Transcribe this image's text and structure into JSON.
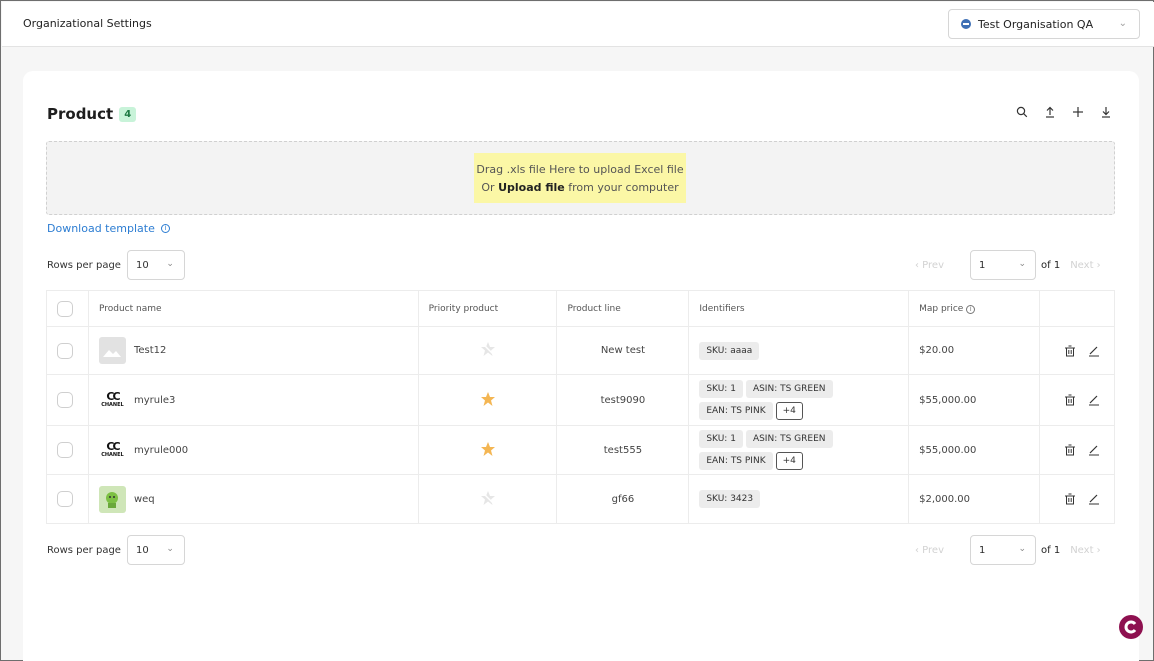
{
  "header": {
    "title": "Organizational Settings",
    "org_selector": {
      "value": "Test Organisation QA"
    }
  },
  "product": {
    "heading": "Product",
    "count": "4",
    "toolbar_icons": [
      "search-icon",
      "upload-icon",
      "add-icon",
      "download-icon"
    ]
  },
  "upload": {
    "line1": "Drag .xls file Here to upload Excel file",
    "line2_prefix": "Or ",
    "line2_link": "Upload file",
    "line2_suffix": " from your computer"
  },
  "download_template": "Download template",
  "pagination": {
    "rows_per_page_label": "Rows per page",
    "rows_per_page_value": "10",
    "prev": "‹ Prev",
    "page": "1",
    "of": "of 1",
    "next": "Next ›"
  },
  "table": {
    "columns": [
      "Product name",
      "Priority product",
      "Product line",
      "Identifiers",
      "Map price"
    ],
    "rows": [
      {
        "name": "Test12",
        "thumb": "placeholder-image",
        "priority": false,
        "line": "New test",
        "tags": [
          "SKU: aaaa"
        ],
        "more": "",
        "price": "$20.00"
      },
      {
        "name": "myrule3",
        "thumb": "chanel-logo",
        "priority": true,
        "line": "test9090",
        "tags": [
          "SKU: 1",
          "ASIN: TS GREEN",
          "EAN: TS PINK"
        ],
        "more": "+4",
        "price": "$55,000.00"
      },
      {
        "name": "myrule000",
        "thumb": "chanel-logo",
        "priority": true,
        "line": "test555",
        "tags": [
          "SKU: 1",
          "ASIN: TS GREEN",
          "EAN: TS PINK"
        ],
        "more": "+4",
        "price": "$55,000.00"
      },
      {
        "name": "weq",
        "thumb": "photo",
        "priority": false,
        "line": "gf66",
        "tags": [
          "SKU: 3423"
        ],
        "more": "",
        "price": "$2,000.00"
      }
    ]
  },
  "logo_text": {
    "chanel": "CHANEL"
  },
  "colors": {
    "badge_bg": "#c8f3d9",
    "link": "#2d7dd2",
    "star": "#f4b653",
    "fab": "#8e1150",
    "dropzone_msg": "#fbf7a6"
  }
}
